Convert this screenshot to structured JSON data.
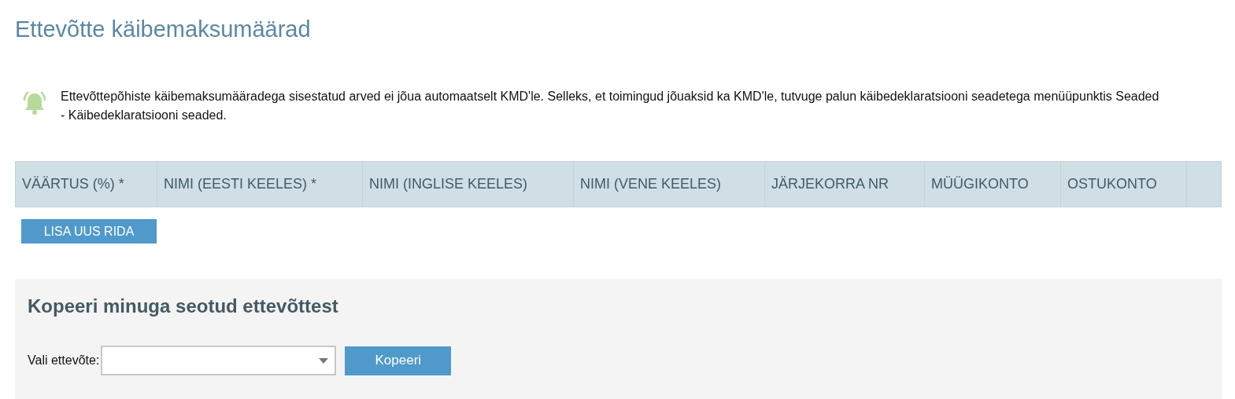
{
  "title": "Ettevõtte käibemaksumäärad",
  "notice": {
    "text": "Ettevõttepõhiste käibemaksumääradega sisestatud arved ei jõua automaatselt KMD'le. Selleks, et toimingud jõuaksid ka KMD'le, tutvuge palun käibedeklaratsiooni seadetega menüüpunktis Seaded - Käibedeklaratsiooni seaded."
  },
  "table": {
    "columns": [
      "VÄÄRTUS (%) *",
      "NIMI (EESTI KEELES) *",
      "NIMI (INGLISE KEELES)",
      "NIMI (VENE KEELES)",
      "JÄRJEKORRA NR",
      "MÜÜGIKONTO",
      "OSTUKONTO"
    ]
  },
  "add_button": "LISA UUS RIDA",
  "copy_section": {
    "title": "Kopeeri minuga seotud ettevõttest",
    "label": "Vali ettevõte:",
    "button": "Kopeeri"
  }
}
